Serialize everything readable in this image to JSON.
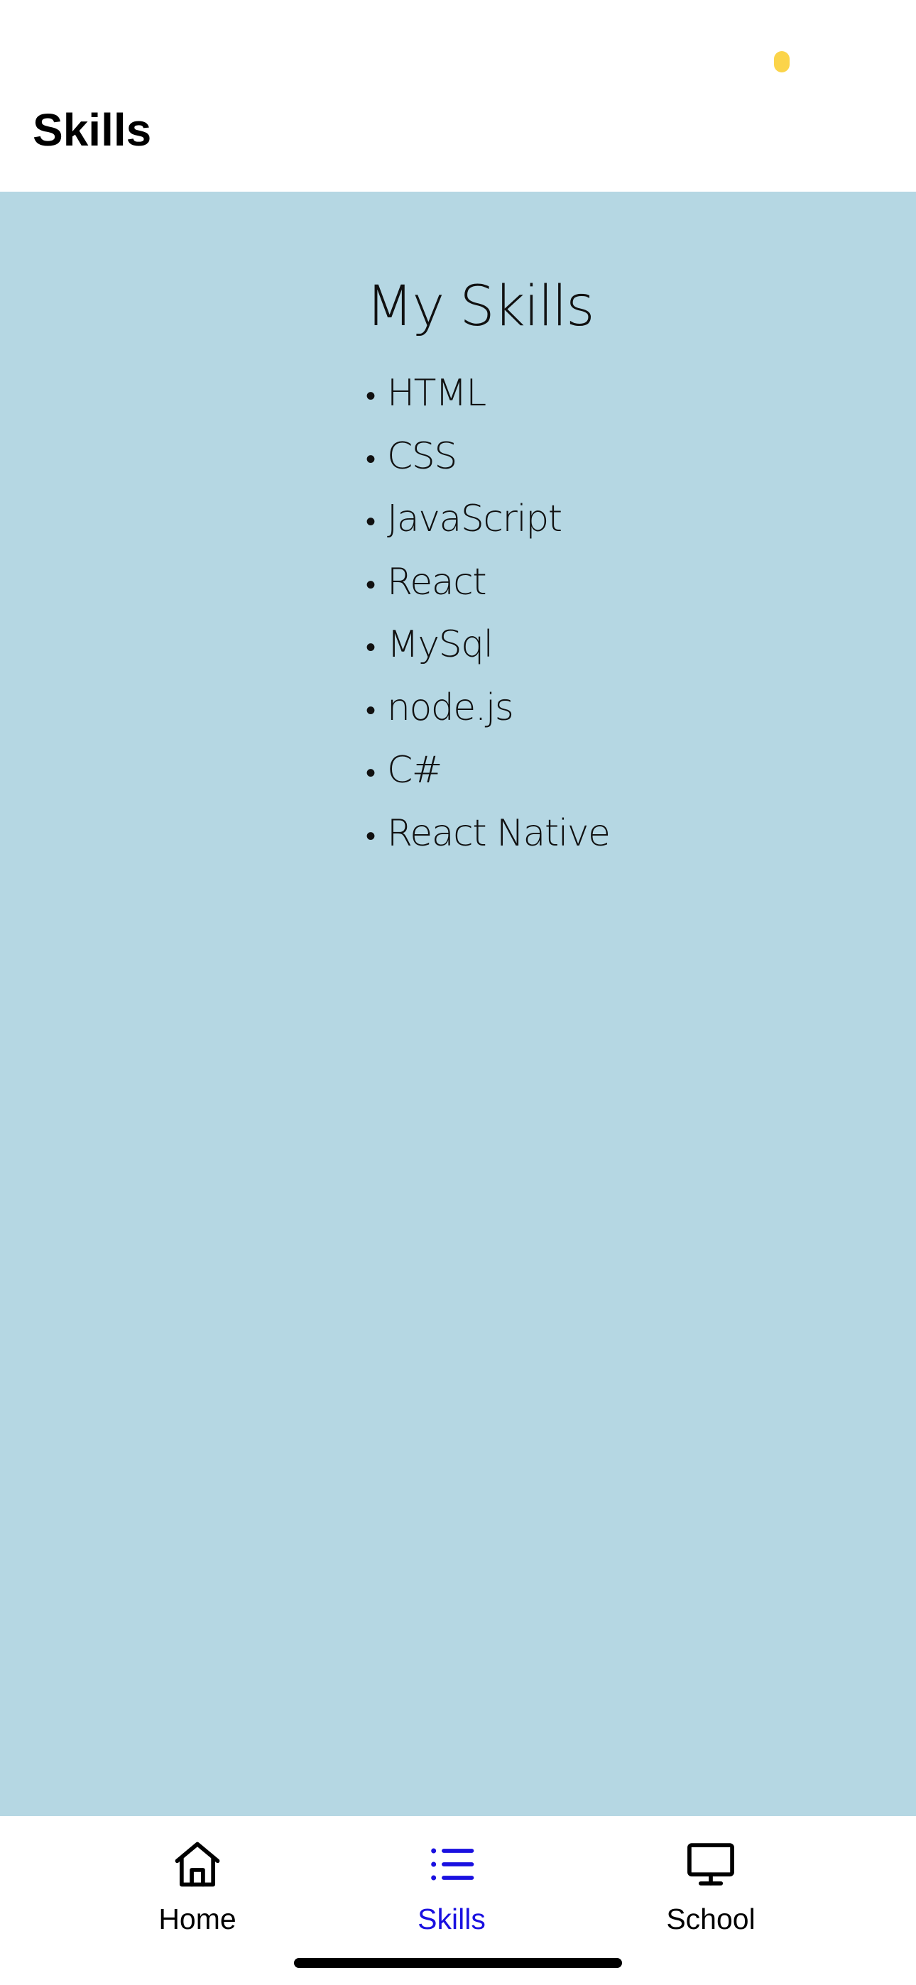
{
  "header": {
    "title": "Skills"
  },
  "main": {
    "heading": "My Skills",
    "bullet": "•",
    "skills": [
      "HTML",
      "CSS",
      "JavaScript",
      "React",
      "MySql",
      "node.js",
      "C#",
      "React Native"
    ]
  },
  "tab_bar": {
    "tabs": [
      {
        "label": "Home",
        "icon": "home-icon",
        "active": false
      },
      {
        "label": "Skills",
        "icon": "list-icon",
        "active": true
      },
      {
        "label": "School",
        "icon": "monitor-icon",
        "active": false
      }
    ]
  },
  "colors": {
    "content_background": "#b5d7e3",
    "active_tab": "#1a10e0",
    "inactive_tab": "#000000",
    "status_indicator": "#fbd44a"
  }
}
